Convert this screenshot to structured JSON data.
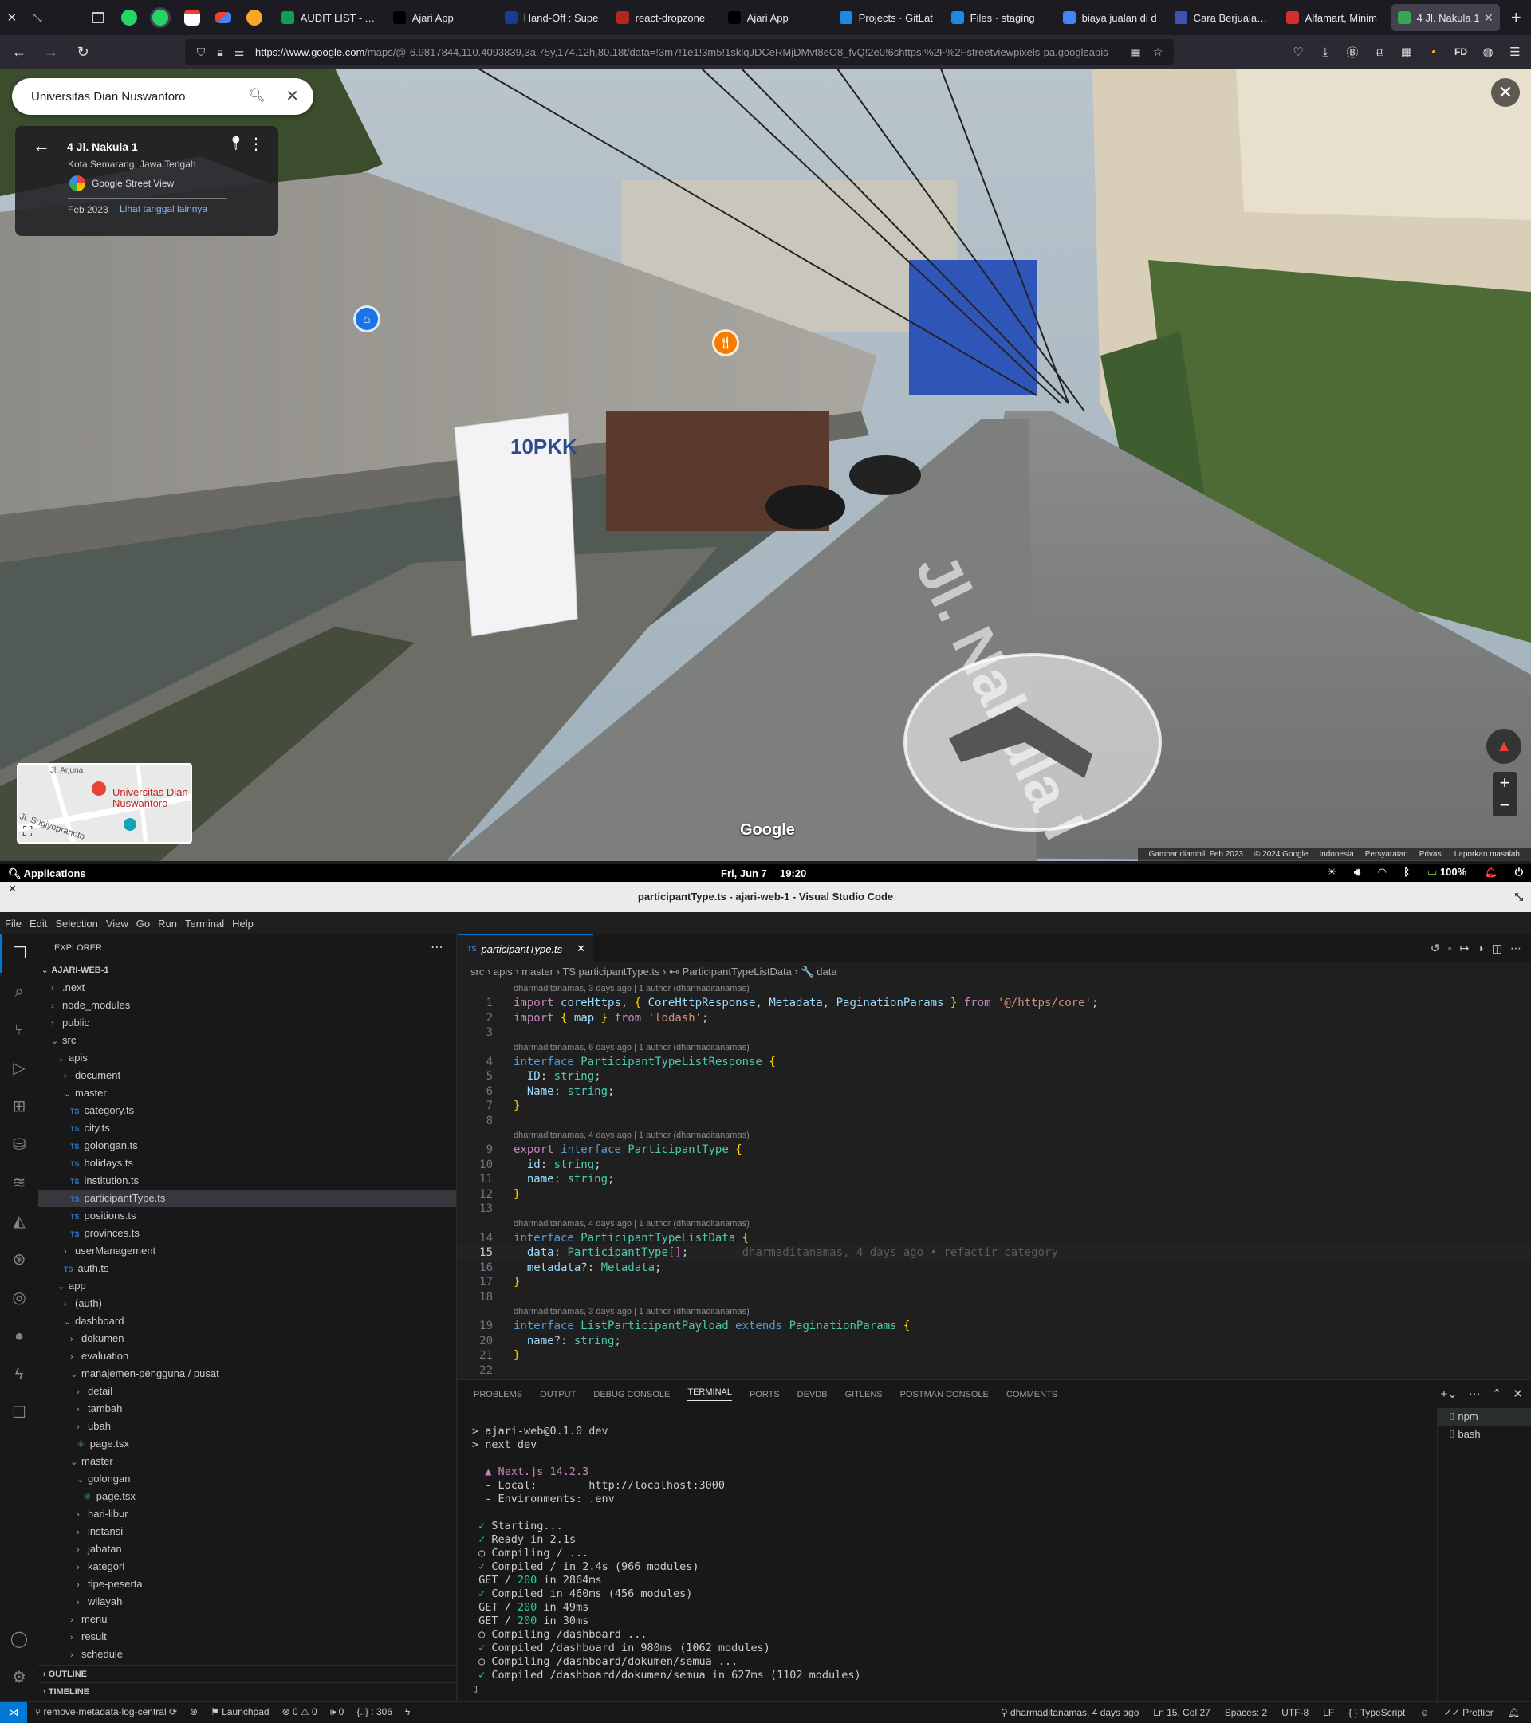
{
  "browser": {
    "tabs": [
      {
        "label": "AUDIT LIST - A...",
        "color": "#0f9d58"
      },
      {
        "label": "Ajari App",
        "color": "#000000"
      },
      {
        "label": "Hand-Off : Supe",
        "color": "#1a3c8f"
      },
      {
        "label": "react-dropzone",
        "color": "#b3261e"
      },
      {
        "label": "Ajari App",
        "color": "#000000"
      },
      {
        "label": "Projects · GitLat",
        "color": "#1e88e5"
      },
      {
        "label": "Files · staging",
        "color": "#1e88e5"
      },
      {
        "label": "biaya jualan di d",
        "color": "#4285f4"
      },
      {
        "label": "Cara Berjualan d",
        "color": "#3f51b5"
      },
      {
        "label": "Alfamart, Minim",
        "color": "#d32f2f"
      },
      {
        "label": "4 Jl. Nakula 1",
        "color": "#34a853"
      }
    ],
    "new_tab": "+",
    "url_host": "https://www.google.com",
    "url_path": "/maps/@-6.9817844,110.4093839,3a,75y,174.12h,80.18t/data=!3m7!1e1!3m5!1sklqJDCeRMjDMvt8eO8_fvQ!2e0!6shttps:%2F%2Fstreetviewpixels-pa.googleapis",
    "profile": "FD"
  },
  "streetview": {
    "search_value": "Universitas Dian Nuswantoro",
    "place_title": "4 Jl. Nakula 1",
    "place_sub": "Kota Semarang, Jawa Tengah",
    "source": "Google Street View",
    "capture_date": "Feb 2023",
    "more_dates": "Lihat tanggal lainnya",
    "minimap_label": "Universitas Dian Nuswantoro",
    "minimap_road": "Jl. Sugiyopranoto",
    "minimap_road2": "Jl. Arjuna",
    "logo": "Google",
    "street_sign": "Jl. Nakula I",
    "attribution": [
      "Gambar diambil: Feb 2023",
      "© 2024 Google",
      "Indonesia",
      "Persyaratan",
      "Privasi",
      "Laporkan masalah"
    ]
  },
  "system": {
    "applications": "Applications",
    "date": "Fri, Jun 7",
    "time": "19:20",
    "battery": "100%"
  },
  "vscode": {
    "title": "participantType.ts - ajari-web-1 - Visual Studio Code",
    "menu": [
      "File",
      "Edit",
      "Selection",
      "View",
      "Go",
      "Run",
      "Terminal",
      "Help"
    ],
    "explorer_title": "EXPLORER",
    "root": "AJARI-WEB-1",
    "tree": [
      {
        "label": ".next",
        "depth": 1,
        "kind": "folder"
      },
      {
        "label": "node_modules",
        "depth": 1,
        "kind": "folder"
      },
      {
        "label": "public",
        "depth": 1,
        "kind": "folder"
      },
      {
        "label": "src",
        "depth": 1,
        "kind": "open"
      },
      {
        "label": "apis",
        "depth": 2,
        "kind": "open"
      },
      {
        "label": "document",
        "depth": 3,
        "kind": "folder"
      },
      {
        "label": "master",
        "depth": 3,
        "kind": "open"
      },
      {
        "label": "category.ts",
        "depth": 4,
        "kind": "ts"
      },
      {
        "label": "city.ts",
        "depth": 4,
        "kind": "ts"
      },
      {
        "label": "golongan.ts",
        "depth": 4,
        "kind": "ts"
      },
      {
        "label": "holidays.ts",
        "depth": 4,
        "kind": "ts"
      },
      {
        "label": "institution.ts",
        "depth": 4,
        "kind": "ts"
      },
      {
        "label": "participantType.ts",
        "depth": 4,
        "kind": "ts",
        "selected": true
      },
      {
        "label": "positions.ts",
        "depth": 4,
        "kind": "ts"
      },
      {
        "label": "provinces.ts",
        "depth": 4,
        "kind": "ts"
      },
      {
        "label": "userManagement",
        "depth": 3,
        "kind": "folder"
      },
      {
        "label": "auth.ts",
        "depth": 3,
        "kind": "ts"
      },
      {
        "label": "app",
        "depth": 2,
        "kind": "open"
      },
      {
        "label": "(auth)",
        "depth": 3,
        "kind": "folder"
      },
      {
        "label": "dashboard",
        "depth": 3,
        "kind": "open"
      },
      {
        "label": "dokumen",
        "depth": 4,
        "kind": "folder"
      },
      {
        "label": "evaluation",
        "depth": 4,
        "kind": "folder"
      },
      {
        "label": "manajemen-pengguna / pusat",
        "depth": 4,
        "kind": "open"
      },
      {
        "label": "detail",
        "depth": 5,
        "kind": "folder"
      },
      {
        "label": "tambah",
        "depth": 5,
        "kind": "folder"
      },
      {
        "label": "ubah",
        "depth": 5,
        "kind": "folder"
      },
      {
        "label": "page.tsx",
        "depth": 5,
        "kind": "tsx"
      },
      {
        "label": "master",
        "depth": 4,
        "kind": "open"
      },
      {
        "label": "golongan",
        "depth": 5,
        "kind": "open"
      },
      {
        "label": "page.tsx",
        "depth": 6,
        "kind": "tsx"
      },
      {
        "label": "hari-libur",
        "depth": 5,
        "kind": "folder"
      },
      {
        "label": "instansi",
        "depth": 5,
        "kind": "folder"
      },
      {
        "label": "jabatan",
        "depth": 5,
        "kind": "folder"
      },
      {
        "label": "kategori",
        "depth": 5,
        "kind": "folder"
      },
      {
        "label": "tipe-peserta",
        "depth": 5,
        "kind": "folder"
      },
      {
        "label": "wilayah",
        "depth": 5,
        "kind": "folder"
      },
      {
        "label": "menu",
        "depth": 4,
        "kind": "folder"
      },
      {
        "label": "result",
        "depth": 4,
        "kind": "folder"
      },
      {
        "label": "schedule",
        "depth": 4,
        "kind": "folder"
      }
    ],
    "outline": "OUTLINE",
    "timeline": "TIMELINE",
    "tab_label": "participantType.ts",
    "breadcrumbs": "src  ›  apis  ›  master  ›  TS participantType.ts  ›  ⊷ ParticipantTypeListData  ›  🔧 data",
    "blame": [
      "dharmaditanamas, 3 days ago | 1 author (dharmaditanamas)",
      "dharmaditanamas, 6 days ago | 1 author (dharmaditanamas)",
      "dharmaditanamas, 4 days ago | 1 author (dharmaditanamas)",
      "dharmaditanamas, 4 days ago | 1 author (dharmaditanamas)",
      "dharmaditanamas, 3 days ago | 1 author (dharmaditanamas)"
    ],
    "inline_blame": "dharmaditanamas, 4 days ago • refactir category",
    "panel_tabs": [
      "PROBLEMS",
      "OUTPUT",
      "DEBUG CONSOLE",
      "TERMINAL",
      "PORTS",
      "DEVDB",
      "GITLENS",
      "POSTMAN CONSOLE",
      "COMMENTS"
    ],
    "terminal_lines": [
      "> ajari-web@0.1.0 dev",
      "> next dev",
      "",
      "  ▲ Next.js 14.2.3",
      "  - Local:        http://localhost:3000",
      "  - Environments: .env",
      "",
      " ✓ Starting...",
      " ✓ Ready in 2.1s",
      " ○ Compiling / ...",
      " ✓ Compiled / in 2.4s (966 modules)",
      " GET / 200 in 2864ms",
      " ✓ Compiled in 460ms (456 modules)",
      " GET / 200 in 49ms",
      " GET / 200 in 30ms",
      " ○ Compiling /dashboard ...",
      " ✓ Compiled /dashboard in 980ms (1062 modules)",
      " ○ Compiling /dashboard/dokumen/semua ...",
      " ✓ Compiled /dashboard/dokumen/semua in 627ms (1102 modules)"
    ],
    "terminals": [
      "npm",
      "bash"
    ],
    "status_left": {
      "branch": "remove-metadata-log-central",
      "launchpad": "Launchpad",
      "problems": "⊗ 0 ⚠ 0",
      "ports": "🕪 0",
      "chars": "{..} : 306"
    },
    "status_right": {
      "blame": "dharmaditanamas, 4 days ago",
      "cursor": "Ln 15, Col 27",
      "spaces": "Spaces: 2",
      "encoding": "UTF-8",
      "eol": "LF",
      "language": "TypeScript",
      "formatter": "Prettier"
    }
  }
}
